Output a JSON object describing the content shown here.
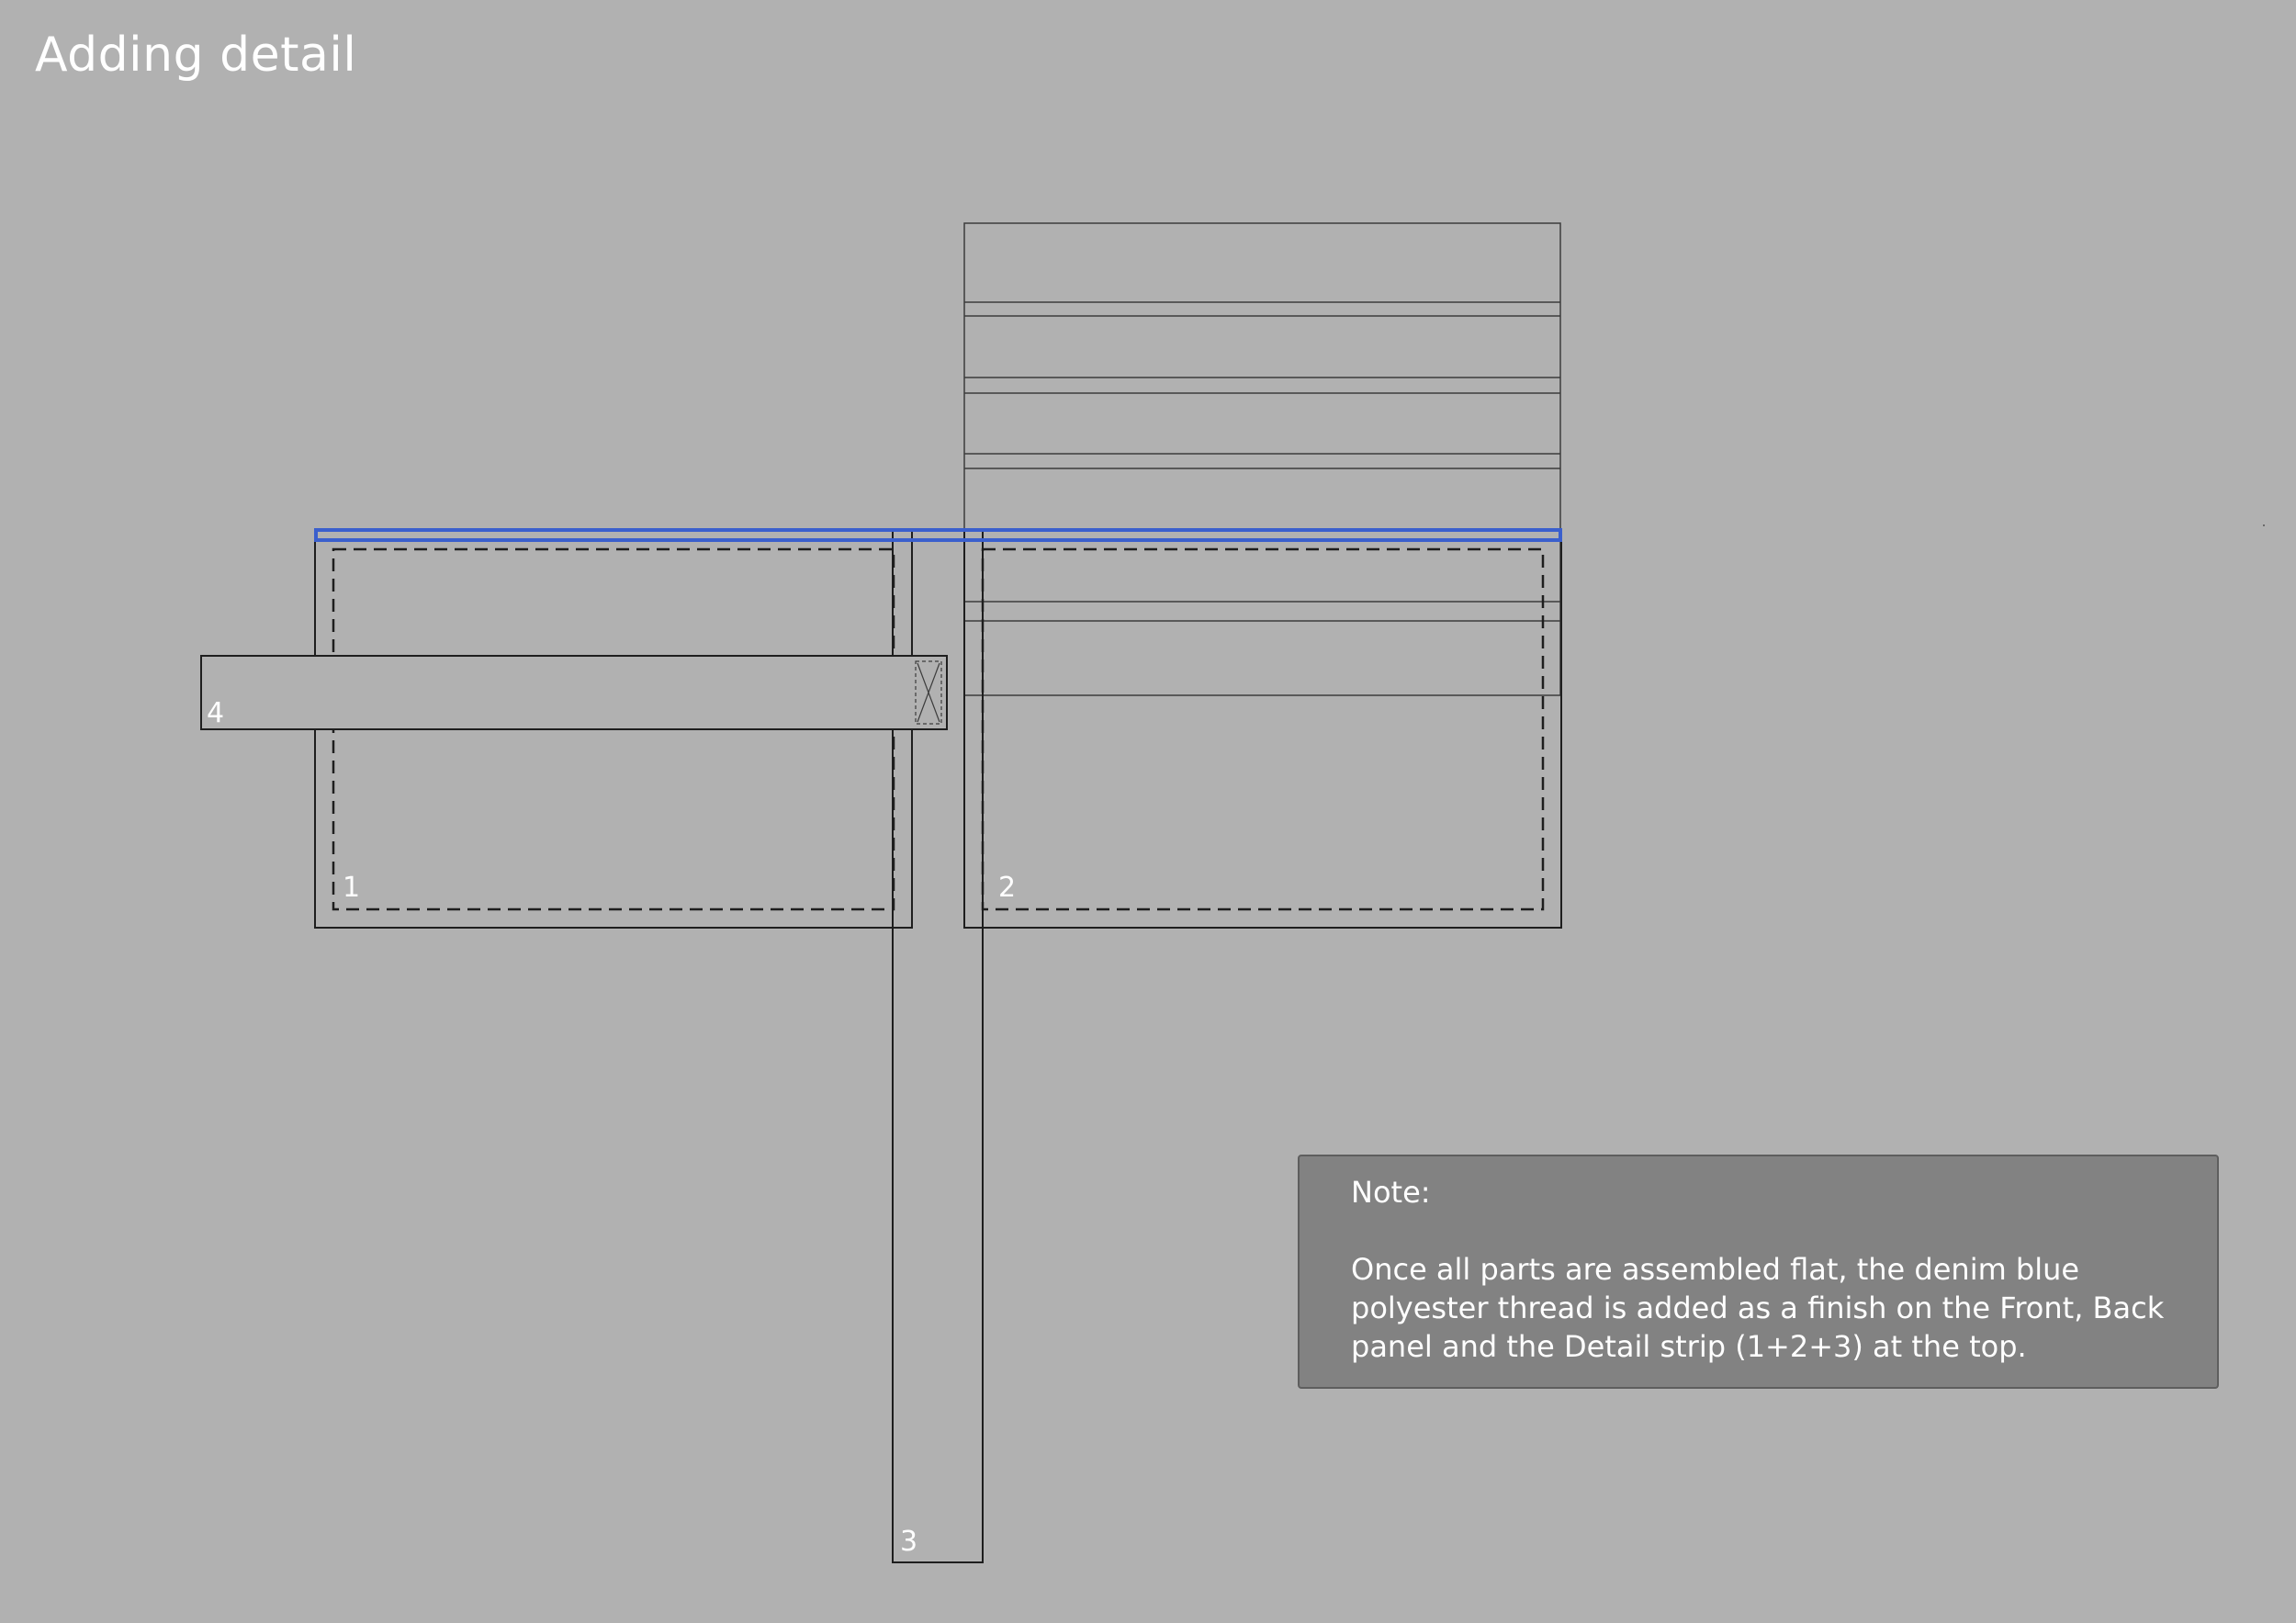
{
  "title": "Adding detail",
  "parts": {
    "front_panel": "1",
    "back_panel": "2",
    "side_strip": "3",
    "pocket_strip": "4"
  },
  "thread_color": "#3a5fcd",
  "note": {
    "heading": "Note:",
    "body": "Once all parts are assembled flat, the denim blue polyester thread is added as a finish on the Front, Back panel and the Detail strip (1+2+3) at the top."
  }
}
